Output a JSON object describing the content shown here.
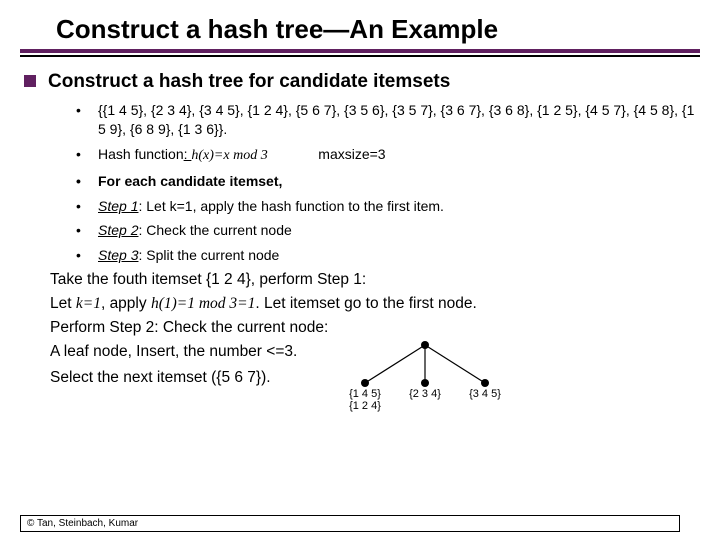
{
  "title": "Construct a hash tree—An Example",
  "main_bullet": "Construct a hash tree for candidate itemsets",
  "sub": {
    "itemsets": "{{1 4 5}, {2 3 4}, {3 4 5}, {1 2 4}, {5 6 7}, {3 5 6}, {3 5 7}, {3 6 7}, {3 6 8}, {1 2 5}, {4 5 7}, {4 5 8}, {1 5 9}, {6 8 9}, {1 3 6}}.",
    "hash_label": "Hash function",
    "hash_colon": ": ",
    "hash_fn": "h(x)=x mod 3",
    "hash_gap": "             ",
    "maxsize": "maxsize=3",
    "for_each": "For each candidate itemset,",
    "step1_label": "Step 1",
    "step1_text": ": Let k=1, apply the hash function to the first item.",
    "step2_label": "Step 2",
    "step2_text": ": Check the current node",
    "step3_label": "Step 3",
    "step3_text": ": Split the current node"
  },
  "paras": {
    "p1": "Take the fouth itemset {1 2 4}, perform Step 1:",
    "p2a": "Let ",
    "p2_k": "k=1",
    "p2b": ", apply ",
    "p2_h": "h(1)=1 mod 3=1",
    "p2c": ". Let itemset go to the first node.",
    "p3": "Perform  Step 2: Check the current node:",
    "p4": "A leaf node, Insert, the number <=3.",
    "p5": "Select the next itemset ({5 6 7})."
  },
  "tree": {
    "leaf1a": "{1 4 5}",
    "leaf1b": "{1 2 4}",
    "leaf2": "{2 3 4}",
    "leaf3": "{3 4 5}"
  },
  "footer": "© Tan, Steinbach, Kumar"
}
